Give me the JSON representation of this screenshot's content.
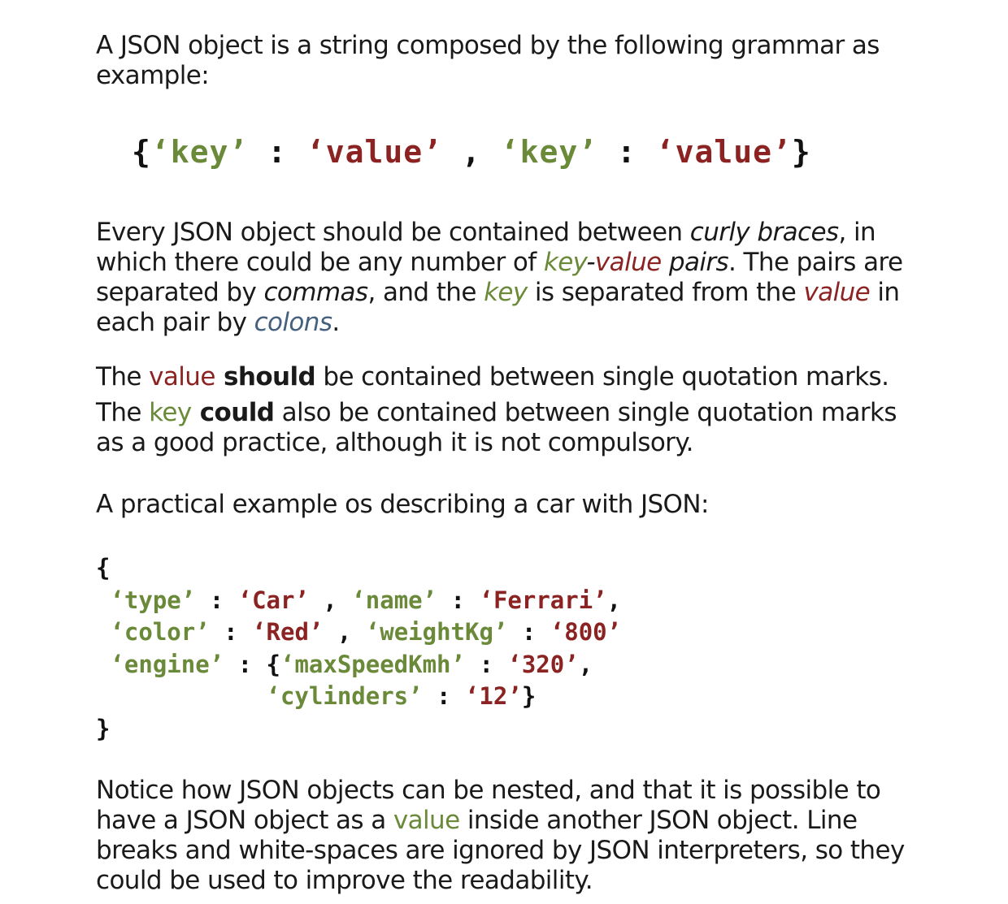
{
  "intro": {
    "text": "A JSON object is a string composed by the following grammar as example:"
  },
  "grammar": {
    "open": "{",
    "key1": "‘key’",
    "colon1": " : ",
    "value1": "‘value’",
    "comma": " , ",
    "key2": "‘key’",
    "colon2": " : ",
    "value2": "‘value’",
    "close": "}"
  },
  "rules": {
    "p1_a": "Every JSON object should be contained between ",
    "p1_curly": "curly braces",
    "p1_b": ", in which there could be any number of ",
    "p1_key": "key",
    "p1_dash": "-",
    "p1_value": "value",
    "p1_pairs": " pairs",
    "p1_c": ". The pairs are separated by ",
    "p1_commas": "commas",
    "p1_d": ", and the ",
    "p1_key2": "key",
    "p1_e": " is separated from the ",
    "p1_value2": "value",
    "p1_f": " in each pair by ",
    "p1_colons": "colons",
    "p1_g": ".",
    "p2_a": "The ",
    "p2_value": "value",
    "p2_should": " should",
    "p2_b": " be contained between single quotation marks.",
    "p3_a": "The ",
    "p3_key": "key",
    "p3_could": " could",
    "p3_b": " also be contained between single quotation marks as a good practice, although it is not compulsory."
  },
  "example_intro": {
    "text": "A practical example os describing a car with JSON:"
  },
  "car_example": {
    "open": "{",
    "l1_k1": "‘type’",
    "l1_s1": " : ",
    "l1_v1": "‘Car’",
    "l1_s2": " , ",
    "l1_k2": "‘name’",
    "l1_s3": " : ",
    "l1_v2": "‘Ferrari’",
    "l1_s4": ",",
    "l2_k1": "‘color’",
    "l2_s1": " : ",
    "l2_v1": "‘Red’",
    "l2_s2": " , ",
    "l2_k2": "‘weightKg’",
    "l2_s3": " : ",
    "l2_v2": "‘800’",
    "l3_k1": "‘engine’",
    "l3_s1": " : {",
    "l3_k2": "‘maxSpeedKmh’",
    "l3_s2": " : ",
    "l3_v1": "‘320’",
    "l3_s3": ",",
    "l4_k1": "‘cylinders’",
    "l4_s1": " : ",
    "l4_v1": "‘12’",
    "l4_s2": "}",
    "close": "}"
  },
  "notice": {
    "a": "Notice how JSON objects can be nested, and that it is possible to have a JSON object as a ",
    "value": "value",
    "b": " inside another JSON object. Line breaks and white-spaces are ignored by JSON interpreters, so they could be used to improve the readability."
  },
  "colors": {
    "key": "#6a8a3a",
    "value": "#8b2323",
    "colon": "#44607e"
  }
}
